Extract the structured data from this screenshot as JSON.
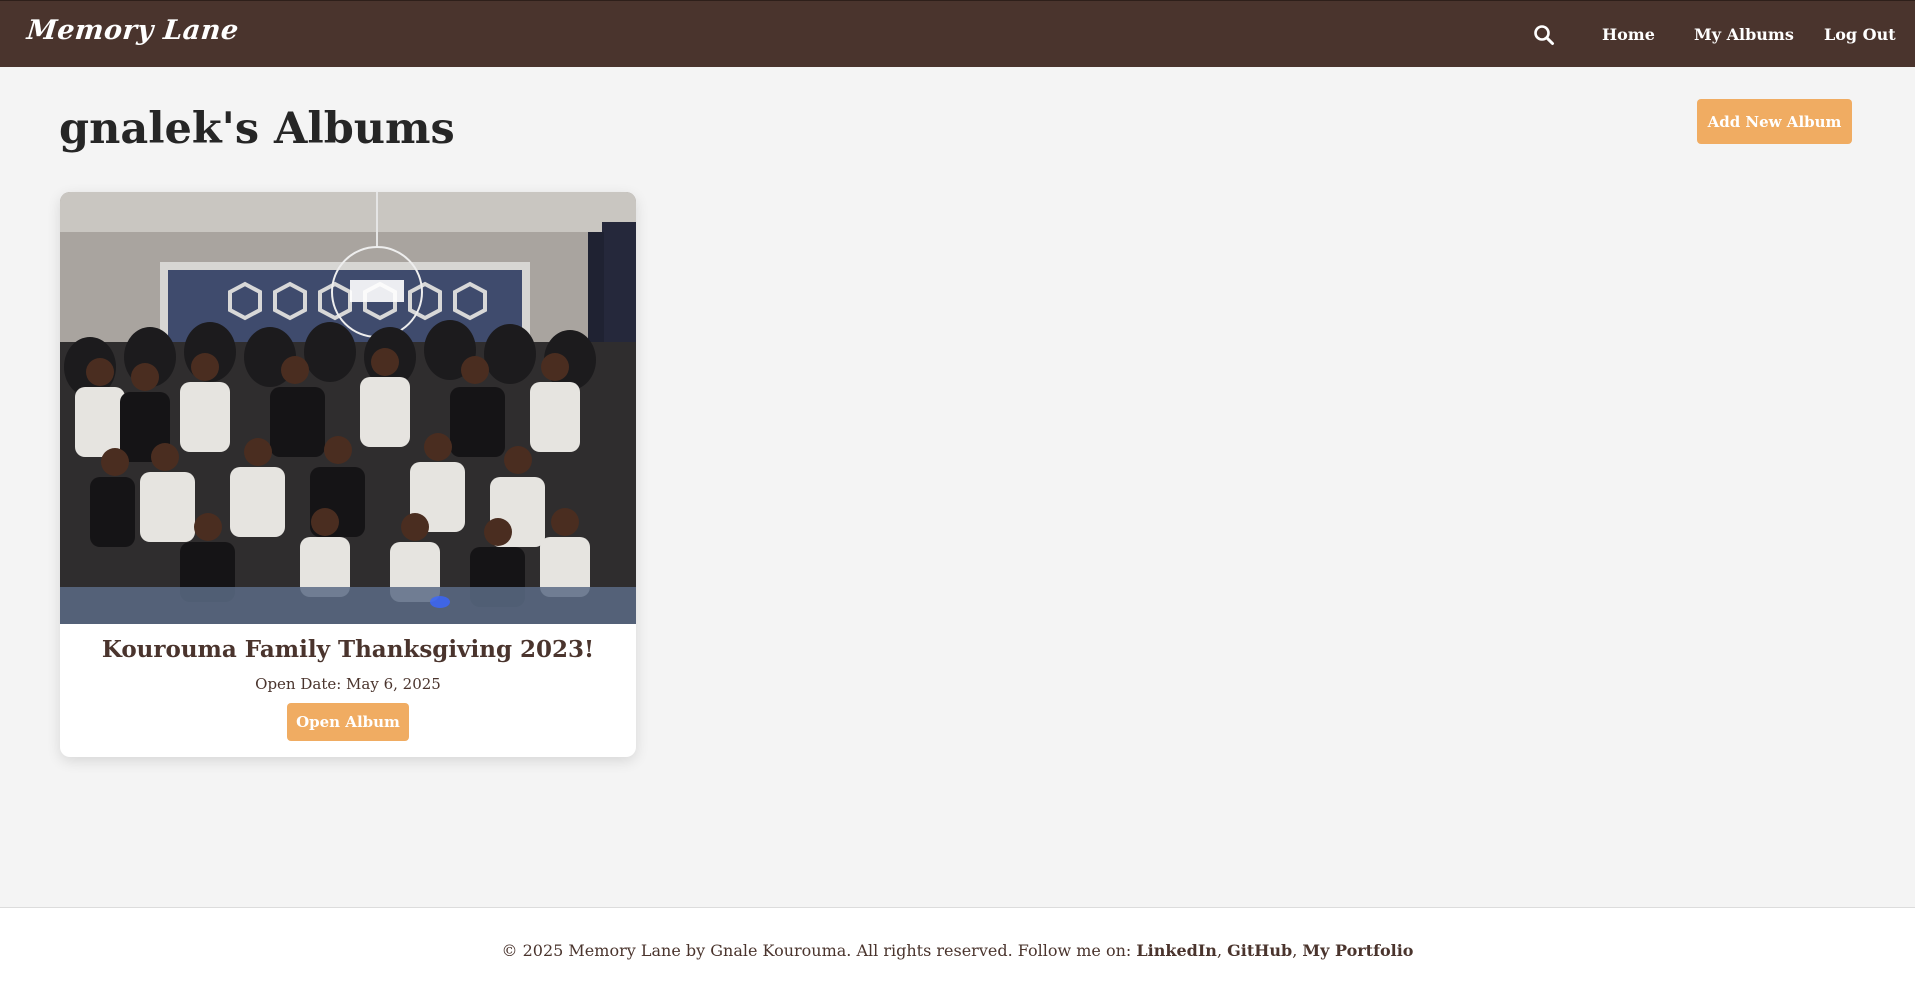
{
  "brand": {
    "name": "Memory Lane"
  },
  "nav": {
    "search_icon": "search-icon",
    "links": [
      {
        "label": "Home"
      },
      {
        "label": "My Albums"
      },
      {
        "label": "Log Out"
      }
    ]
  },
  "header": {
    "title": "gnalek's Albums",
    "add_button": "Add New Album"
  },
  "albums": [
    {
      "title": "Kourouma Family Thanksgiving 2023!",
      "open_date": "Open Date: May 6, 2025",
      "open_button": "Open Album"
    }
  ],
  "footer": {
    "text": "© 2025 Memory Lane by Gnale Kourouma. All rights reserved. Follow me on:",
    "links": [
      {
        "label": "LinkedIn"
      },
      {
        "label": "GitHub"
      },
      {
        "label": "My Portfolio"
      }
    ],
    "separator": ","
  },
  "colors": {
    "navbar": "#4a342d",
    "accent": "#f0ac62",
    "background": "#f4f4f4"
  }
}
